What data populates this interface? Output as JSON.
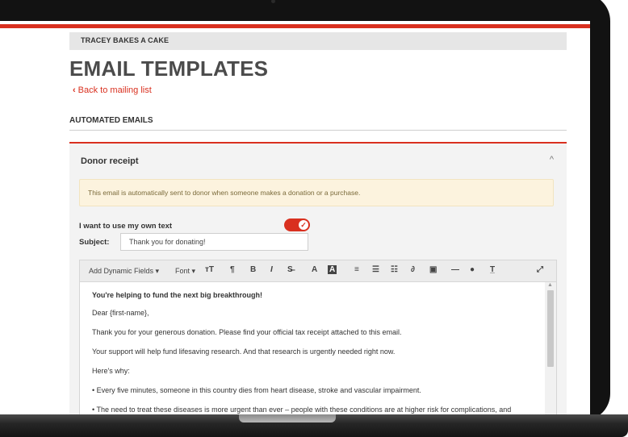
{
  "org": {
    "name": "TRACEY BAKES A CAKE"
  },
  "page": {
    "title": "EMAIL TEMPLATES",
    "back_link": "Back to mailing list"
  },
  "section": {
    "heading": "AUTOMATED EMAILS"
  },
  "card": {
    "title": "Donor receipt",
    "notice": "This email is automatically sent to donor when someone makes a donation or a purchase.",
    "own_text_label": "I want to use my own text",
    "own_text_enabled": true,
    "subject_label": "Subject:",
    "subject_value": "Thank you for donating!"
  },
  "toolbar": {
    "dynamic_fields": "Add Dynamic Fields",
    "font": "Font",
    "icons": [
      "font-size-icon",
      "paragraph-icon",
      "bold-icon",
      "italic-icon",
      "strikethrough-icon",
      "font-color-icon",
      "highlight-icon",
      "align-icon",
      "bulleted-list-icon",
      "numbered-list-icon",
      "link-icon",
      "image-icon",
      "horizontal-rule-icon",
      "emoji-icon",
      "clear-formatting-icon",
      "fullscreen-icon"
    ]
  },
  "editor": {
    "paragraphs": [
      "You're helping to fund the next big breakthrough!",
      "Dear {first-name},",
      "Thank you for your generous donation. Please find your official tax receipt attached to this email.",
      "Your support will help fund lifesaving research. And that research is urgently needed right now.",
      "Here's why:",
      "• Every five minutes, someone in this country dies from heart disease, stroke and vascular impairment.",
      "• The need to treat these diseases is more urgent than ever – people with these conditions are at higher risk for complications, and"
    ]
  },
  "colors": {
    "accent": "#d9301f",
    "notice_bg": "#fcf3de"
  }
}
